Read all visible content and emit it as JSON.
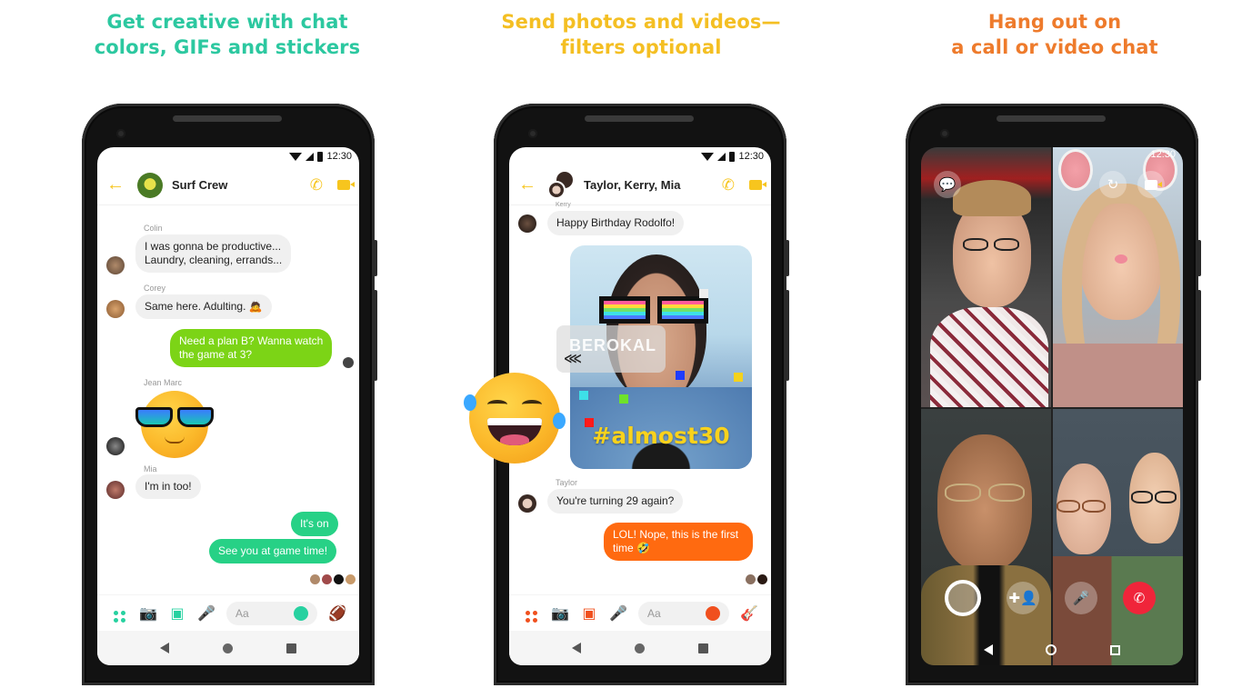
{
  "panels": [
    {
      "headline": [
        "Get creative with chat",
        "colors, GIFs and stickers"
      ],
      "accent": "#2cc8a0",
      "status_time": "12:30",
      "chat_title": "Surf Crew",
      "messages": [
        {
          "sender": "Colin",
          "lines": [
            "I was gonna be productive...",
            "Laundry, cleaning, errands..."
          ],
          "direction": "in"
        },
        {
          "sender": "Corey",
          "lines": [
            "Same here. Adulting. 🙇"
          ],
          "direction": "in"
        },
        {
          "sender": "",
          "lines": [
            "Need a plan B? Wanna watch",
            "the game at 3?"
          ],
          "direction": "out",
          "color": "#7cd416"
        },
        {
          "sender": "Jean Marc",
          "sticker": "cool-sunglasses-emoji-sticker",
          "direction": "in"
        },
        {
          "sender": "Mia",
          "lines": [
            "I'm in too!"
          ],
          "direction": "in"
        },
        {
          "sender": "",
          "lines": [
            "It's on"
          ],
          "direction": "out",
          "color": "#27d186"
        },
        {
          "sender": "",
          "lines": [
            "See you at game time!"
          ],
          "direction": "out",
          "color": "#27d186"
        }
      ],
      "composer_placeholder": "Aa",
      "composer_icons": [
        "more-icon",
        "camera-icon",
        "gallery-icon",
        "microphone-icon",
        "emoji-icon",
        "football-icon"
      ]
    },
    {
      "headline": [
        "Send photos and videos—",
        "filters optional"
      ],
      "accent": "#f4bf23",
      "status_time": "12:30",
      "chat_title": "Taylor, Kerry, Mia",
      "messages": [
        {
          "sender": "Kerry",
          "lines": [
            "Happy Birthday Rodolfo!"
          ],
          "direction": "in"
        },
        {
          "sender": "",
          "photo_caption": "#almost30",
          "direction": "out"
        },
        {
          "sender": "Taylor",
          "lines": [
            "You're turning 29 again?"
          ],
          "direction": "in"
        },
        {
          "sender": "",
          "lines": [
            "LOL! Nope, this is the first",
            "time 🤣"
          ],
          "direction": "out",
          "color": "#ff6a10"
        }
      ],
      "watermark": "BEROKAL",
      "composer_placeholder": "Aa",
      "composer_icons": [
        "more-icon",
        "camera-icon",
        "gallery-icon",
        "microphone-icon",
        "emoji-icon",
        "guitar-icon"
      ]
    },
    {
      "headline": [
        "Hang out on",
        "a call or video chat"
      ],
      "accent": "#ee7b2c",
      "status_time": "12:30",
      "call_controls": [
        "capture-button",
        "add-person-button",
        "mute-microphone-button",
        "end-call-button"
      ],
      "top_controls": [
        "chat-button",
        "flip-camera-button",
        "video-toggle-button"
      ],
      "participants": 4
    }
  ]
}
